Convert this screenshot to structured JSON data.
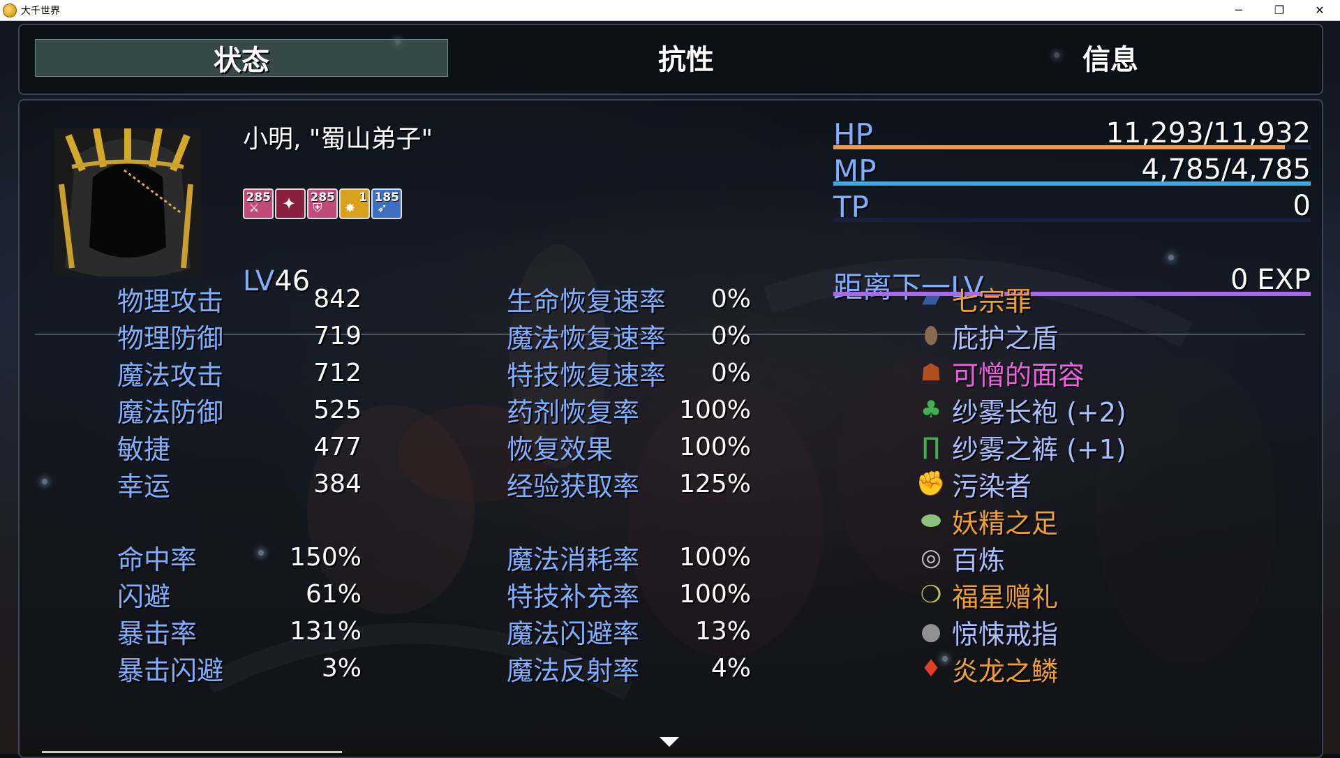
{
  "window": {
    "title": "大千世界",
    "minimize": "─",
    "restore": "❐",
    "close": "✕"
  },
  "tabs": [
    {
      "label": "状态",
      "active": true
    },
    {
      "label": "抗性",
      "active": false
    },
    {
      "label": "信息",
      "active": false
    }
  ],
  "character": {
    "name": "小明, \"蜀山弟子\"",
    "level_prefix": "LV",
    "level": "46",
    "buffs": [
      {
        "number": "285",
        "icon": "sword-up-icon",
        "color": "#c04a7a"
      },
      {
        "number": "",
        "icon": "beast-icon",
        "color": "#8a2040"
      },
      {
        "number": "285",
        "icon": "shield-up-icon",
        "color": "#c04a7a"
      },
      {
        "number": "1",
        "icon": "burst-icon",
        "color": "#d9a020"
      },
      {
        "number": "185",
        "icon": "wing-icon",
        "color": "#3d6fc0"
      }
    ]
  },
  "gauges": {
    "hp": {
      "label": "HP",
      "value": "11,293/11,932",
      "fraction": 0.9464,
      "color": "#e89a4a"
    },
    "mp": {
      "label": "MP",
      "value": "4,785/4,785",
      "fraction": 1.0,
      "color": "#3fa8e0"
    },
    "tp": {
      "label": "TP",
      "value": "0",
      "fraction": 0,
      "color": "#60c060"
    },
    "exp": {
      "label": "距离下一LV",
      "value": "0 EXP",
      "fraction": 1.0,
      "color": "#a868e8"
    }
  },
  "stats_left": [
    {
      "name": "物理攻击",
      "value": "842"
    },
    {
      "name": "物理防御",
      "value": "719"
    },
    {
      "name": "魔法攻击",
      "value": "712"
    },
    {
      "name": "魔法防御",
      "value": "525"
    },
    {
      "name": "敏捷",
      "value": "477"
    },
    {
      "name": "幸运",
      "value": "384"
    },
    {
      "name": "命中率",
      "value": "150%"
    },
    {
      "name": "闪避",
      "value": "61%"
    },
    {
      "name": "暴击率",
      "value": "131%"
    },
    {
      "name": "暴击闪避",
      "value": "3%"
    }
  ],
  "stats_mid": [
    {
      "name": "生命恢复速率",
      "value": "0%"
    },
    {
      "name": "魔法恢复速率",
      "value": "0%"
    },
    {
      "name": "特技恢复速率",
      "value": "0%"
    },
    {
      "name": "药剂恢复率",
      "value": "100%"
    },
    {
      "name": "恢复效果",
      "value": "100%"
    },
    {
      "name": "经验获取率",
      "value": "125%"
    },
    {
      "name": "魔法消耗率",
      "value": "100%"
    },
    {
      "name": "特技补充率",
      "value": "100%"
    },
    {
      "name": "魔法闪避率",
      "value": "13%"
    },
    {
      "name": "魔法反射率",
      "value": "4%"
    }
  ],
  "equipment": [
    {
      "name": "七宗罪",
      "color": "#f0a030",
      "icon": "book-icon"
    },
    {
      "name": "庇护之盾",
      "color": "#a8c0ff",
      "icon": "shield-icon"
    },
    {
      "name": "可憎的面容",
      "color": "#f060e0",
      "icon": "mask-icon"
    },
    {
      "name": "纱雾长袍 (+2)",
      "color": "#a8c0ff",
      "icon": "robe-icon"
    },
    {
      "name": "纱雾之裤 (+1)",
      "color": "#a8c0ff",
      "icon": "pants-icon"
    },
    {
      "name": "污染者",
      "color": "#a8c0ff",
      "icon": "gauntlet-icon"
    },
    {
      "name": "妖精之足",
      "color": "#f0a030",
      "icon": "boot-icon"
    },
    {
      "name": "百炼",
      "color": "#a8c0ff",
      "icon": "bracelet-icon"
    },
    {
      "name": "福星赠礼",
      "color": "#f0a030",
      "icon": "amulet-icon"
    },
    {
      "name": "惊悚戒指",
      "color": "#a8c0ff",
      "icon": "ring-icon"
    },
    {
      "name": "炎龙之鳞",
      "color": "#f0a030",
      "icon": "scale-icon"
    }
  ]
}
